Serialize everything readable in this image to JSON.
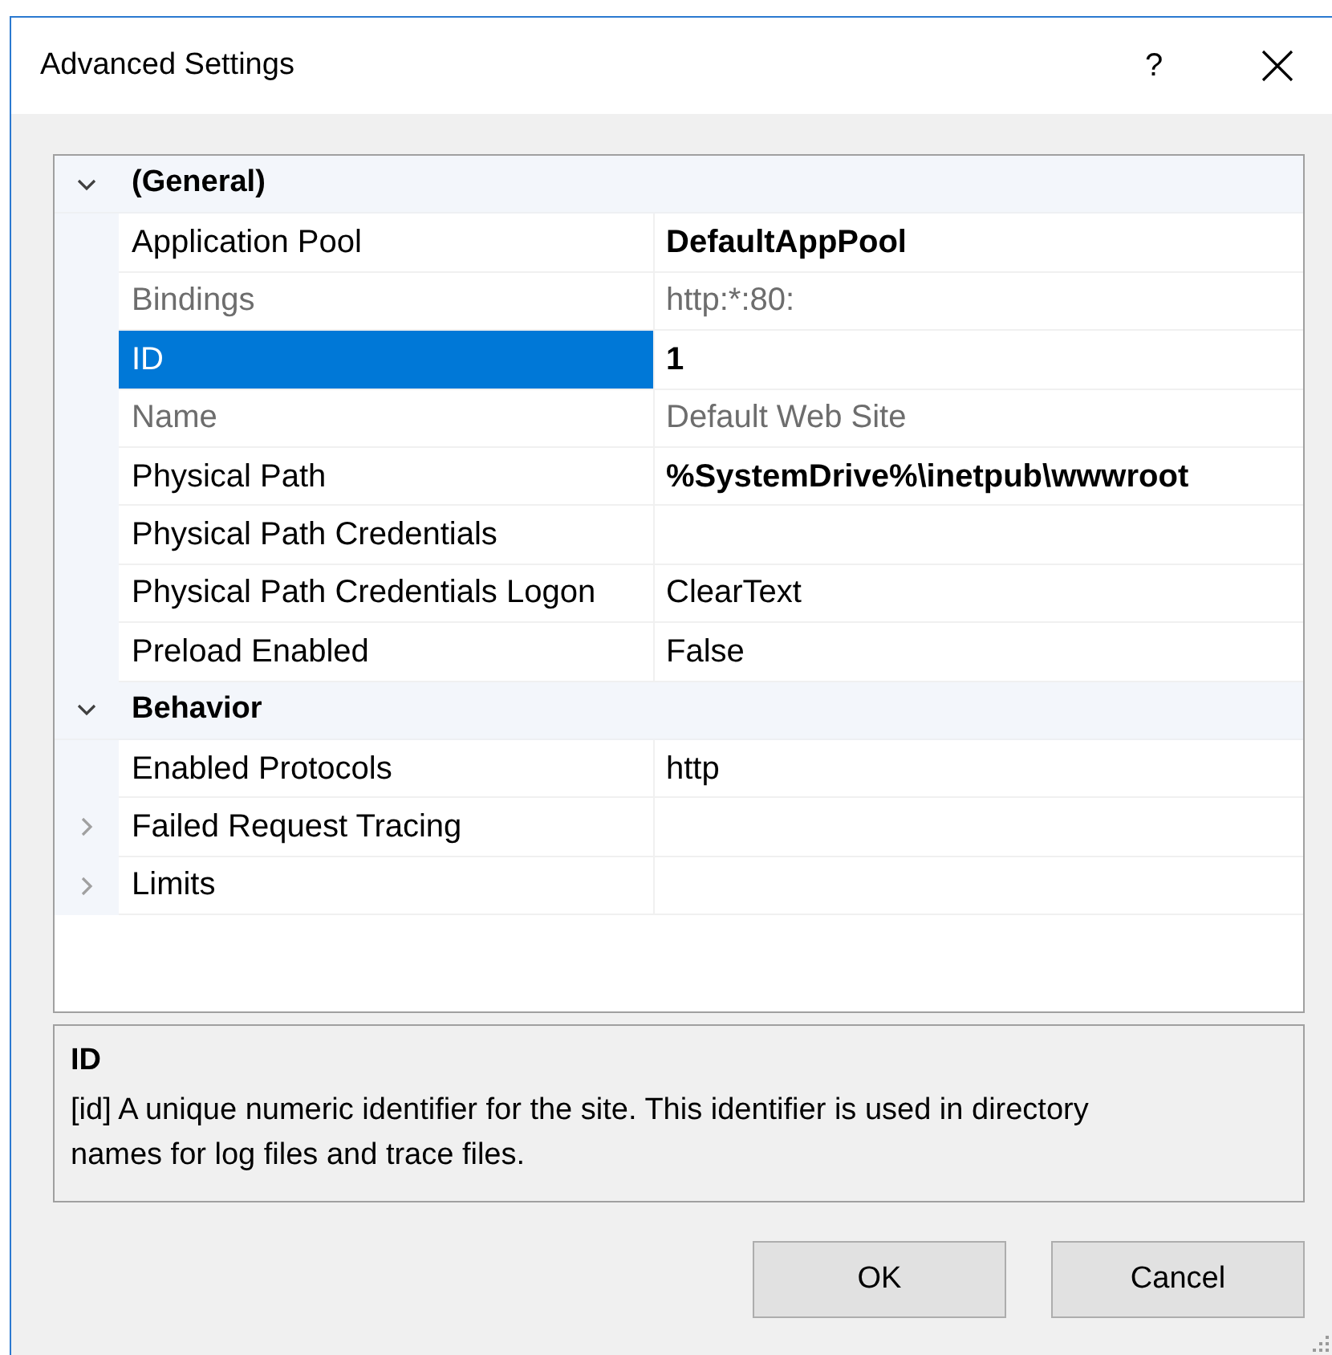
{
  "window": {
    "title": "Advanced Settings",
    "help": "?"
  },
  "property_grid": {
    "categories": [
      {
        "name": "(General)",
        "expanded": true,
        "properties": [
          {
            "kind": "property",
            "name": "Application Pool",
            "value": "DefaultAppPool",
            "bold": true,
            "disabled": false,
            "selected": false
          },
          {
            "kind": "property",
            "name": "Bindings",
            "value": "http:*:80:",
            "bold": false,
            "disabled": true,
            "selected": false
          },
          {
            "kind": "property",
            "name": "ID",
            "value": "1",
            "bold": true,
            "disabled": false,
            "selected": true
          },
          {
            "kind": "property",
            "name": "Name",
            "value": "Default Web Site",
            "bold": false,
            "disabled": true,
            "selected": false
          },
          {
            "kind": "property",
            "name": "Physical Path",
            "value": "%SystemDrive%\\inetpub\\wwwroot",
            "bold": true,
            "disabled": false,
            "selected": false
          },
          {
            "kind": "property",
            "name": "Physical Path Credentials",
            "disabled": false,
            "selected": false
          },
          {
            "kind": "property",
            "name": "Physical Path Credentials Logon",
            "value": "ClearText",
            "bold": false,
            "disabled": false,
            "selected": false
          },
          {
            "kind": "property",
            "name": "Preload Enabled",
            "value": "False",
            "bold": false,
            "disabled": false,
            "selected": false
          }
        ]
      },
      {
        "name": "Behavior",
        "expanded": true,
        "properties": [
          {
            "kind": "property",
            "name": "Enabled Protocols",
            "value": "http",
            "bold": false,
            "disabled": false,
            "selected": false
          },
          {
            "kind": "group",
            "name": "Failed Request Tracing",
            "expanded": false,
            "disabled": false,
            "selected": false
          },
          {
            "kind": "group",
            "name": "Limits",
            "expanded": false,
            "disabled": false,
            "selected": false
          }
        ]
      }
    ]
  },
  "description": {
    "title": "ID",
    "text": "[id] A unique numeric identifier for the site. This identifier is used in directory names for log files and trace files."
  },
  "buttons": [
    {
      "label": "OK"
    },
    {
      "label": "Cancel"
    }
  ]
}
